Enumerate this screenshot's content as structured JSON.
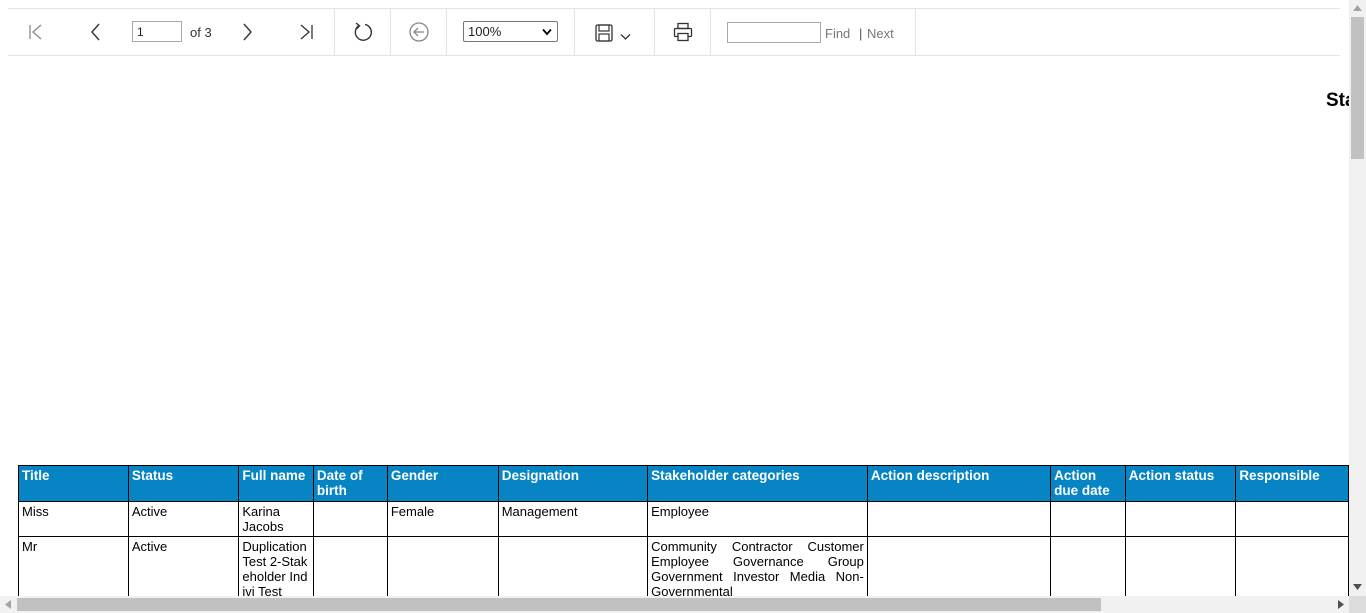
{
  "toolbar": {
    "page_value": "1",
    "page_of": "of 3",
    "zoom_value": "100%",
    "zoom_options": [
      "100%"
    ],
    "find_value": "",
    "find_label": "Find",
    "divider": "|",
    "next_label": "Next",
    "icons": [
      "first-page-icon",
      "previous-page-icon",
      "next-page-icon",
      "last-page-icon",
      "refresh-icon",
      "back-icon",
      "save-icon",
      "chevron-down-icon",
      "print-icon"
    ]
  },
  "report": {
    "title": "Sta",
    "columns": [
      "Title",
      "Status",
      "Full name",
      "Date of birth",
      "Gender",
      "Designation",
      "Stakeholder categories",
      "Action description",
      "Action due date",
      "Action status",
      "Responsible"
    ],
    "rows": [
      [
        "Miss",
        "Active",
        "Karina Jacobs",
        "",
        "Female",
        "Management",
        "Employee",
        "",
        "",
        "",
        ""
      ],
      [
        "Mr",
        "Active",
        "Duplication Test 2-Stakeholder Indivi Test",
        "",
        "",
        "",
        "Community Contractor Customer Employee Governance Group Government Investor Media Non-Governmental",
        "",
        "",
        "",
        ""
      ]
    ]
  },
  "colors": {
    "header_bg": "#0784c3",
    "header_text": "#ffffff",
    "toolbar_border": "#e3e3e3",
    "scrollbar_track": "#f1f1f1",
    "scrollbar_thumb": "#c1c1c1"
  }
}
